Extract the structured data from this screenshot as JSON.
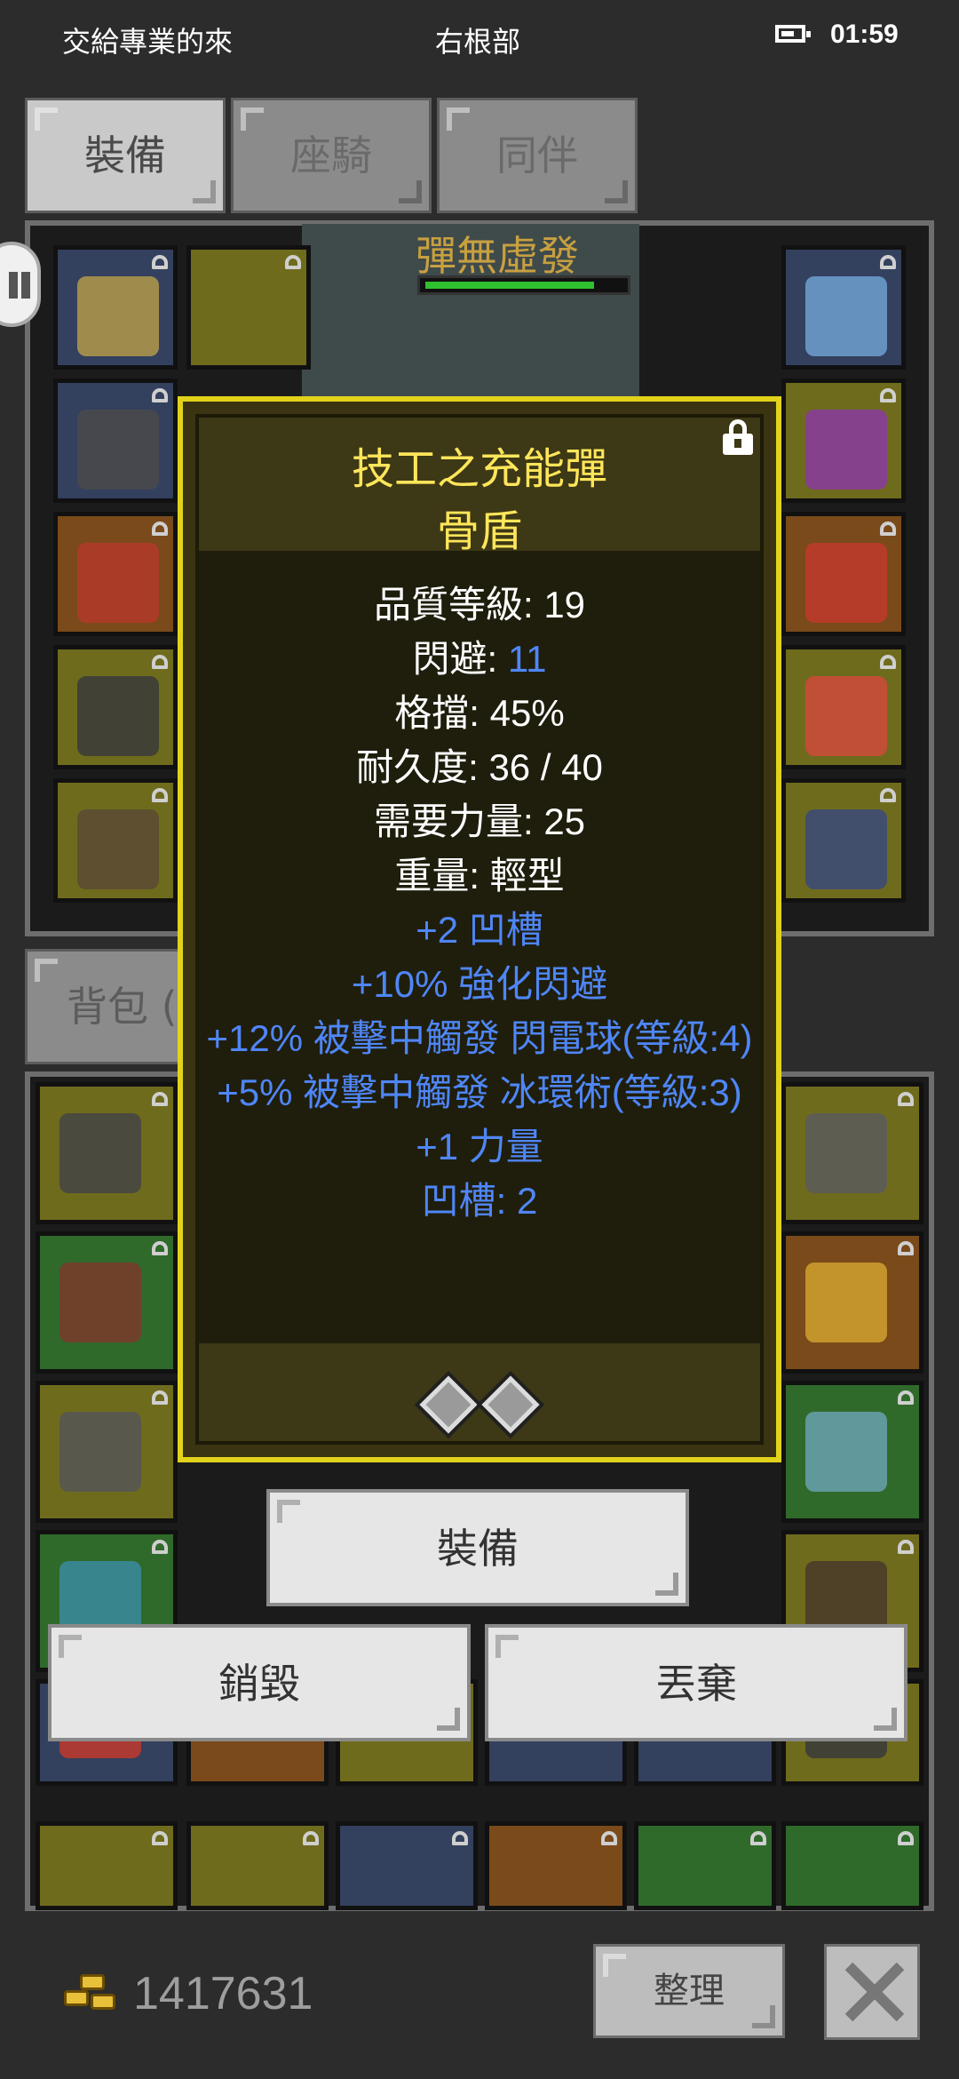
{
  "status_bar": {
    "left_text": "交給專業的來",
    "center_text": "右根部",
    "time": "01:59",
    "battery_icon": "battery-icon"
  },
  "tabs": [
    {
      "label": "裝備",
      "active": true
    },
    {
      "label": "座騎",
      "active": false
    },
    {
      "label": "同伴",
      "active": false
    }
  ],
  "boss_banner": {
    "text": "彈無虛發"
  },
  "bag_tab": {
    "label": "背包 ("
  },
  "tooltip": {
    "name": "技工之充能彈",
    "type": "骨盾",
    "locked": true,
    "stats": [
      {
        "label": "品質等級: ",
        "value": "19"
      },
      {
        "label": "閃避: ",
        "value": "11"
      },
      {
        "label": "格擋: ",
        "value": "45%"
      },
      {
        "label": "耐久度: ",
        "value": "36 / 40"
      },
      {
        "label": "需要力量: ",
        "value": "25"
      },
      {
        "label": "重量: ",
        "value": "輕型"
      }
    ],
    "mods": [
      "+2 凹槽",
      "+10% 強化閃避",
      "+12% 被擊中觸發 閃電球(等級:4)",
      "+5% 被擊中觸發 冰環術(等級:3)",
      "+1 力量",
      "凹槽: 2"
    ],
    "sockets": 2
  },
  "actions": {
    "equip": "裝備",
    "destroy": "銷毀",
    "drop": "丟棄"
  },
  "footer": {
    "gold": "1417631",
    "sort_label": "整理",
    "close_icon": "close-icon"
  },
  "colors": {
    "tooltip_border": "#e2d21a",
    "item_name": "#ffe65a",
    "mod_text": "#4f86f7"
  }
}
